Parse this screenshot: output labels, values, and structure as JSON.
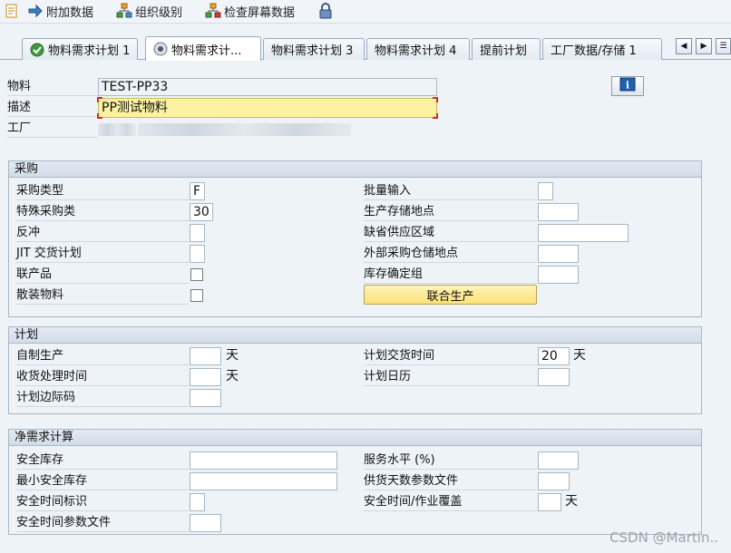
{
  "toolbar": {
    "add_data": "附加数据",
    "org_levels": "组织级别",
    "check_screen": "检查屏幕数据"
  },
  "tabs": [
    {
      "label": "物料需求计划 1"
    },
    {
      "label": "物料需求计..."
    },
    {
      "label": "物料需求计划 3"
    },
    {
      "label": "物料需求计划 4"
    },
    {
      "label": "提前计划"
    },
    {
      "label": "工厂数据/存储 1"
    }
  ],
  "header": {
    "material_label": "物料",
    "material_value": "TEST-PP33",
    "desc_label": "描述",
    "desc_value": "PP测试物料",
    "plant_label": "工厂"
  },
  "purchasing": {
    "title": "采购",
    "procurement_type_label": "采购类型",
    "procurement_type_value": "F",
    "special_proc_label": "特殊采购类",
    "special_proc_value": "30",
    "backflush_label": "反冲",
    "jit_label": "JIT 交货计划",
    "coproduct_label": "联产品",
    "bulk_label": "散装物料",
    "batch_entry_label": "批量输入",
    "prod_stor_loc_label": "生产存储地点",
    "default_supply_area_label": "缺省供应区域",
    "ext_proc_stor_loc_label": "外部采购仓储地点",
    "stor_costing_group_label": "库存确定组",
    "joint_prod_button": "联合生产"
  },
  "planning": {
    "title": "计划",
    "inhouse_label": "自制生产",
    "inhouse_unit": "天",
    "gr_proc_label": "收货处理时间",
    "gr_proc_unit": "天",
    "sched_margin_label": "计划边际码",
    "planned_deliv_label": "计划交货时间",
    "planned_deliv_value": "20",
    "planned_deliv_unit": "天",
    "planning_cal_label": "计划日历"
  },
  "net_req": {
    "title": "净需求计算",
    "safety_stock_label": "安全库存",
    "min_safety_stock_label": "最小安全库存",
    "safety_time_ind_label": "安全时间标识",
    "safety_time_profile_label": "安全时间参数文件",
    "service_level_label": "服务水平 (%)",
    "coverage_profile_label": "供货天数参数文件",
    "safety_time_label": "安全时间/作业覆盖",
    "safety_time_unit": "天"
  },
  "watermark": "CSDN @Martin.."
}
